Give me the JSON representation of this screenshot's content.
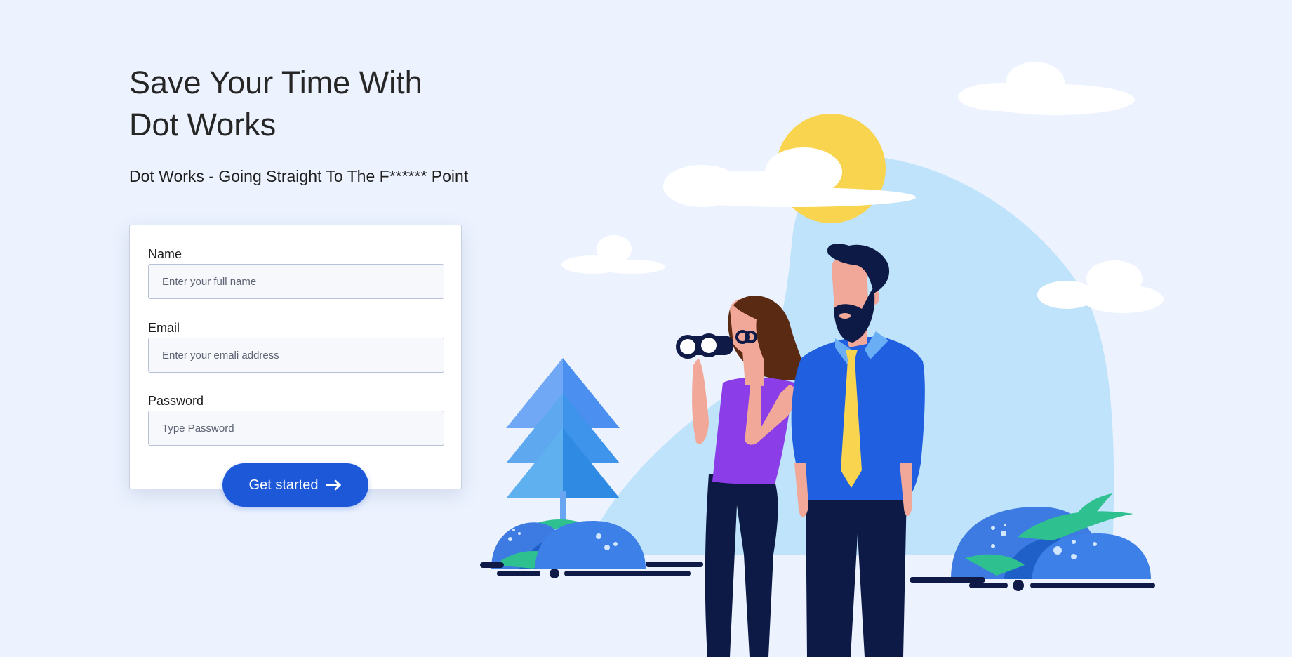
{
  "hero": {
    "title_line1": "Save Your Time With",
    "title_line2": "Dot Works",
    "subtitle": "Dot Works - Going Straight To The F****** Point"
  },
  "form": {
    "name_label": "Name",
    "name_placeholder": "Enter your full name",
    "email_label": "Email",
    "email_placeholder": "Enter your emali address",
    "password_label": "Password",
    "password_placeholder": "Type Password",
    "submit_label": "Get started",
    "submit_icon": "arrow-right-icon"
  },
  "colors": {
    "background": "#ecf2fe",
    "accent": "#1d58d8",
    "sun": "#f8d44f",
    "sky": "#bfe3fb"
  }
}
